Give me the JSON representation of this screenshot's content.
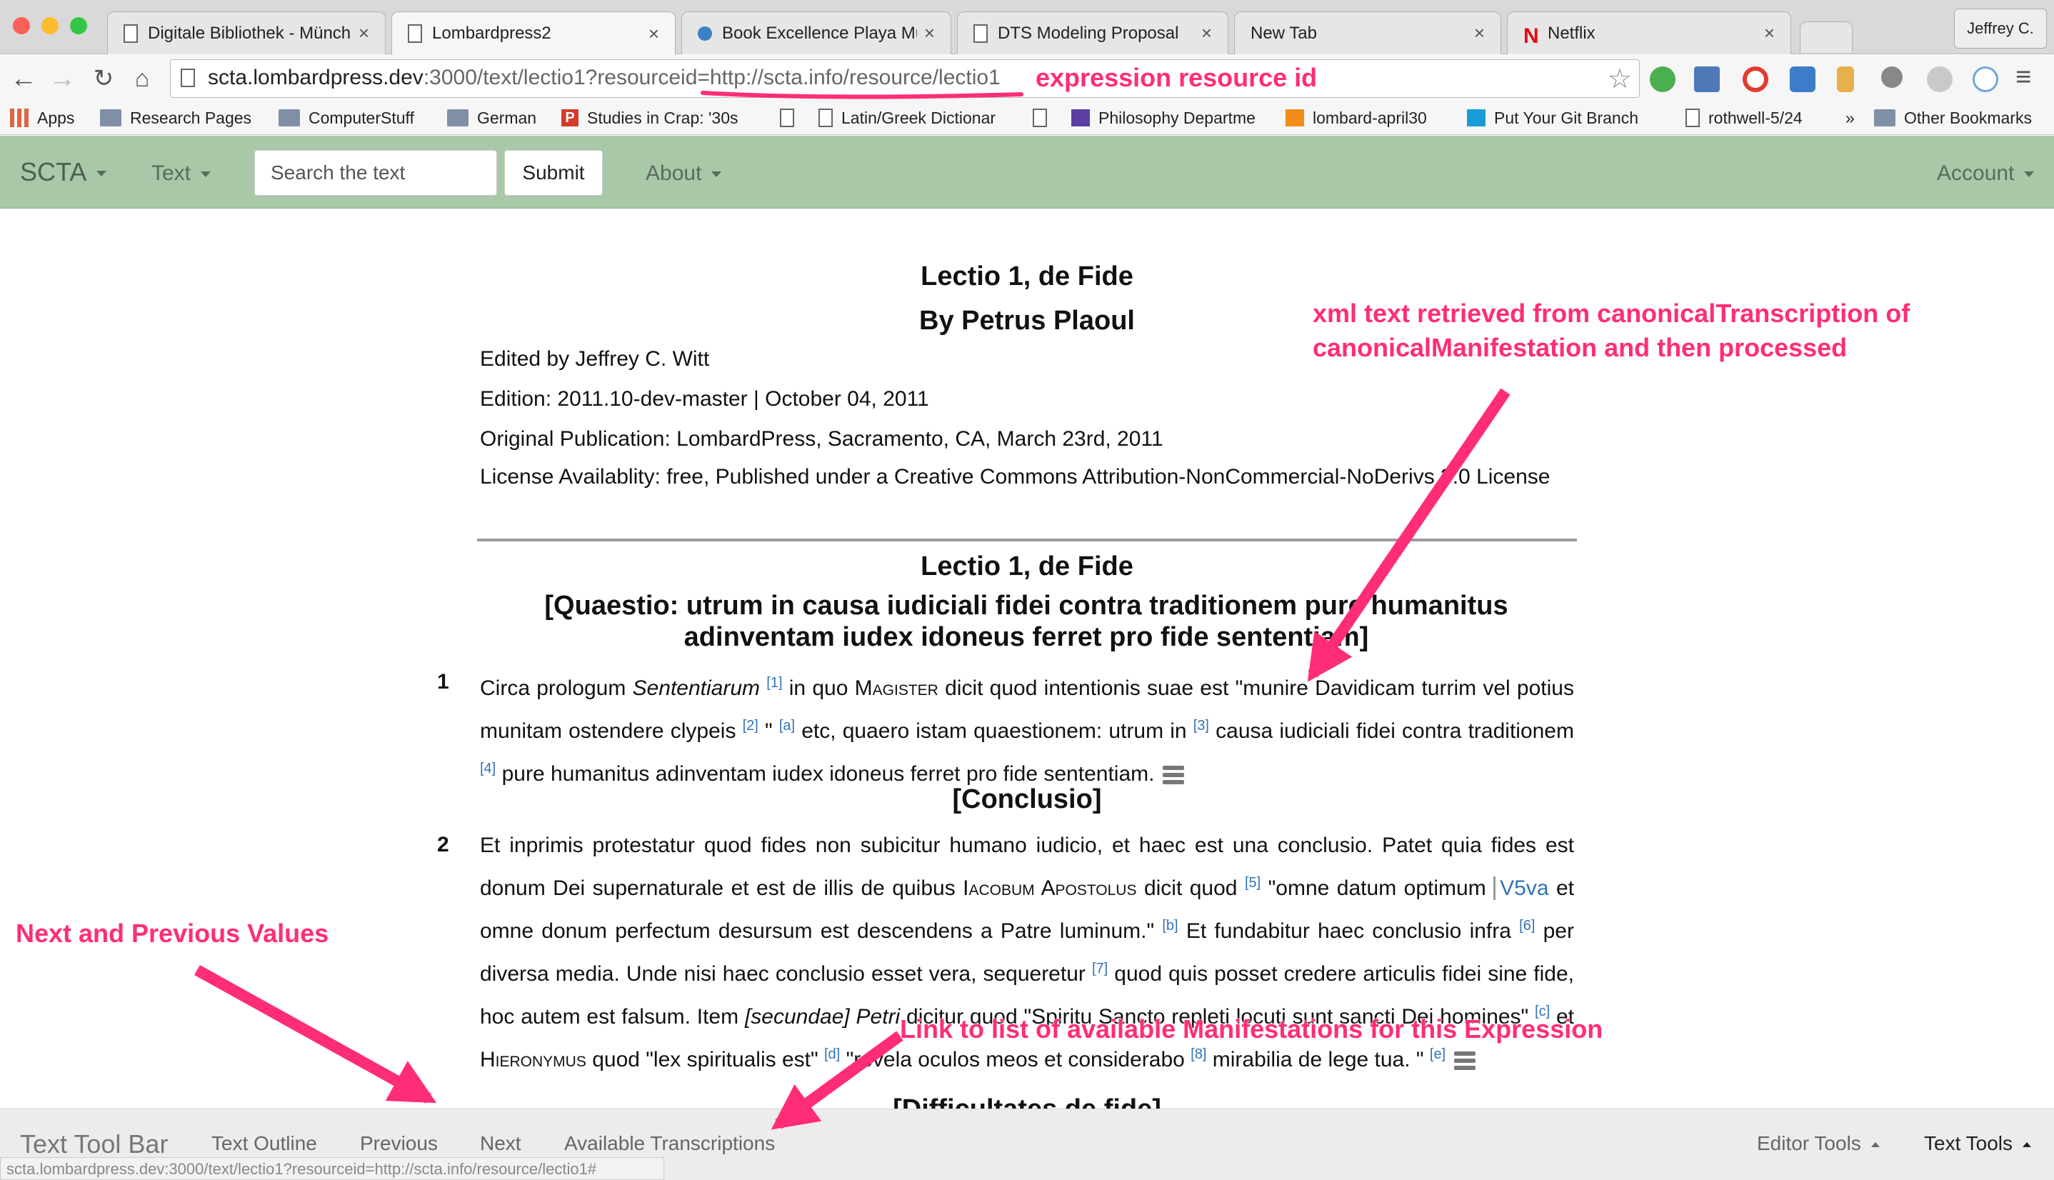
{
  "browser": {
    "tabs": [
      {
        "title": "Digitale Bibliothek - Münch"
      },
      {
        "title": "Lombardpress2"
      },
      {
        "title": "Book Excellence Playa Muje"
      },
      {
        "title": "DTS Modeling Proposal"
      },
      {
        "title": "New Tab"
      },
      {
        "title": "Netflix"
      }
    ],
    "profile": "Jeffrey C.",
    "url_host": "scta.lombardpress.dev",
    "url_path": ":3000/text/lectio1?resourceid=http://scta.info/resource/lectio1",
    "bookmarks": [
      "Apps",
      "Research Pages",
      "ComputerStuff",
      "German",
      "Studies in Crap: '30s",
      "",
      "Latin/Greek Dictionar",
      "",
      "Philosophy Departme",
      "lombard-april30",
      "Put Your Git Branch",
      "rothwell-5/24",
      "»",
      "Other Bookmarks"
    ]
  },
  "site": {
    "brand": "SCTA",
    "text_menu": "Text",
    "search_placeholder": "Search the text",
    "submit_label": "Submit",
    "about_menu": "About",
    "account_menu": "Account"
  },
  "document": {
    "title": "Lectio 1, de Fide",
    "author": "By Petrus Plaoul",
    "editor": "Edited by Jeffrey C. Witt",
    "edition": "Edition: 2011.10-dev-master | October 04, 2011",
    "publication": "Original Publication: LombardPress, Sacramento, CA, March 23rd, 2011",
    "license": "License Availablity: free, Published under a Creative Commons Attribution-NonCommercial-NoDerivs 3.0 License",
    "section_title": "Lectio 1, de Fide",
    "question": "[Quaestio: utrum in causa iudiciali fidei contra traditionem pure humanitus adinventam iudex idoneus ferret pro fide sententiam]",
    "conclusio": "[Conclusio]",
    "next_heading": "[Difficultates de fide]",
    "para1": {
      "num": "1",
      "t1": "Circa prologum ",
      "t2": "Sententiarum",
      "f1": "[1]",
      "t3": " in quo ",
      "t4": "Magister",
      "t5": " dicit quod intentionis suae est \"munire Davidicam turrim vel potius munitam ostendere clypeis ",
      "f2": "[2]",
      "t6": " \" ",
      "f3": "[a]",
      "t7": " etc, quaero istam quaestionem: utrum in ",
      "f4": "[3]",
      "t8": " causa iudiciali fidei contra traditionem ",
      "f5": "[4]",
      "t9": " pure humanitus adinventam iudex idoneus ferret pro fide sententiam."
    },
    "para2": {
      "num": "2",
      "t1": "Et inprimis protestatur quod fides non subicitur humano iudicio, et haec est una conclusio. Patet quia fides est donum Dei supernaturale et est de illis de quibus ",
      "t2": "Iacobum Apostolus",
      "t3": " dicit quod ",
      "f1": "[5]",
      "t4": " \"omne datum optimum ",
      "ref": "V5va",
      "t5": " et omne donum perfectum desursum est descendens a Patre luminum.\" ",
      "f2": "[b]",
      "t6": " Et fundabitur haec conclusio infra ",
      "f3": "[6]",
      "t7": " per diversa media. Unde nisi haec conclusio esset vera, sequeretur ",
      "f4": "[7]",
      "t8": " quod quis posset credere articulis fidei sine fide, hoc autem est falsum. Item ",
      "t9": "[secundae] Petri",
      "t10": " dicitur quod \"Spiritu Sancto repleti locuti sunt sancti Dei homines\" ",
      "f5": "[c]",
      "t11": " et ",
      "t12": "Hieronymus",
      "t13": " quod \"lex spiritualis est\" ",
      "f6": "[d]",
      "t14": " \"revela oculos meos et considerabo ",
      "f7": "[8]",
      "t15": " mirabilia de lege tua. \" ",
      "f8": "[e]"
    }
  },
  "bottom_bar": {
    "brand": "Text Tool Bar",
    "outline": "Text Outline",
    "previous": "Previous",
    "next": "Next",
    "transcriptions": "Available Transcriptions",
    "editor_tools": "Editor Tools",
    "text_tools": "Text Tools",
    "status_url": "scta.lombardpress.dev:3000/text/lectio1?resourceid=http://scta.info/resource/lectio1#"
  },
  "annotations": {
    "resource_id": "expression resource id",
    "xml_line1": "xml text retrieved from canonicalTranscription of",
    "xml_line2": "canonicalManifestation and then processed",
    "next_prev": "Next and Previous Values",
    "manifest_link": "Link to list of available Manifestations for this Expression",
    "color": "#ff2d77"
  }
}
